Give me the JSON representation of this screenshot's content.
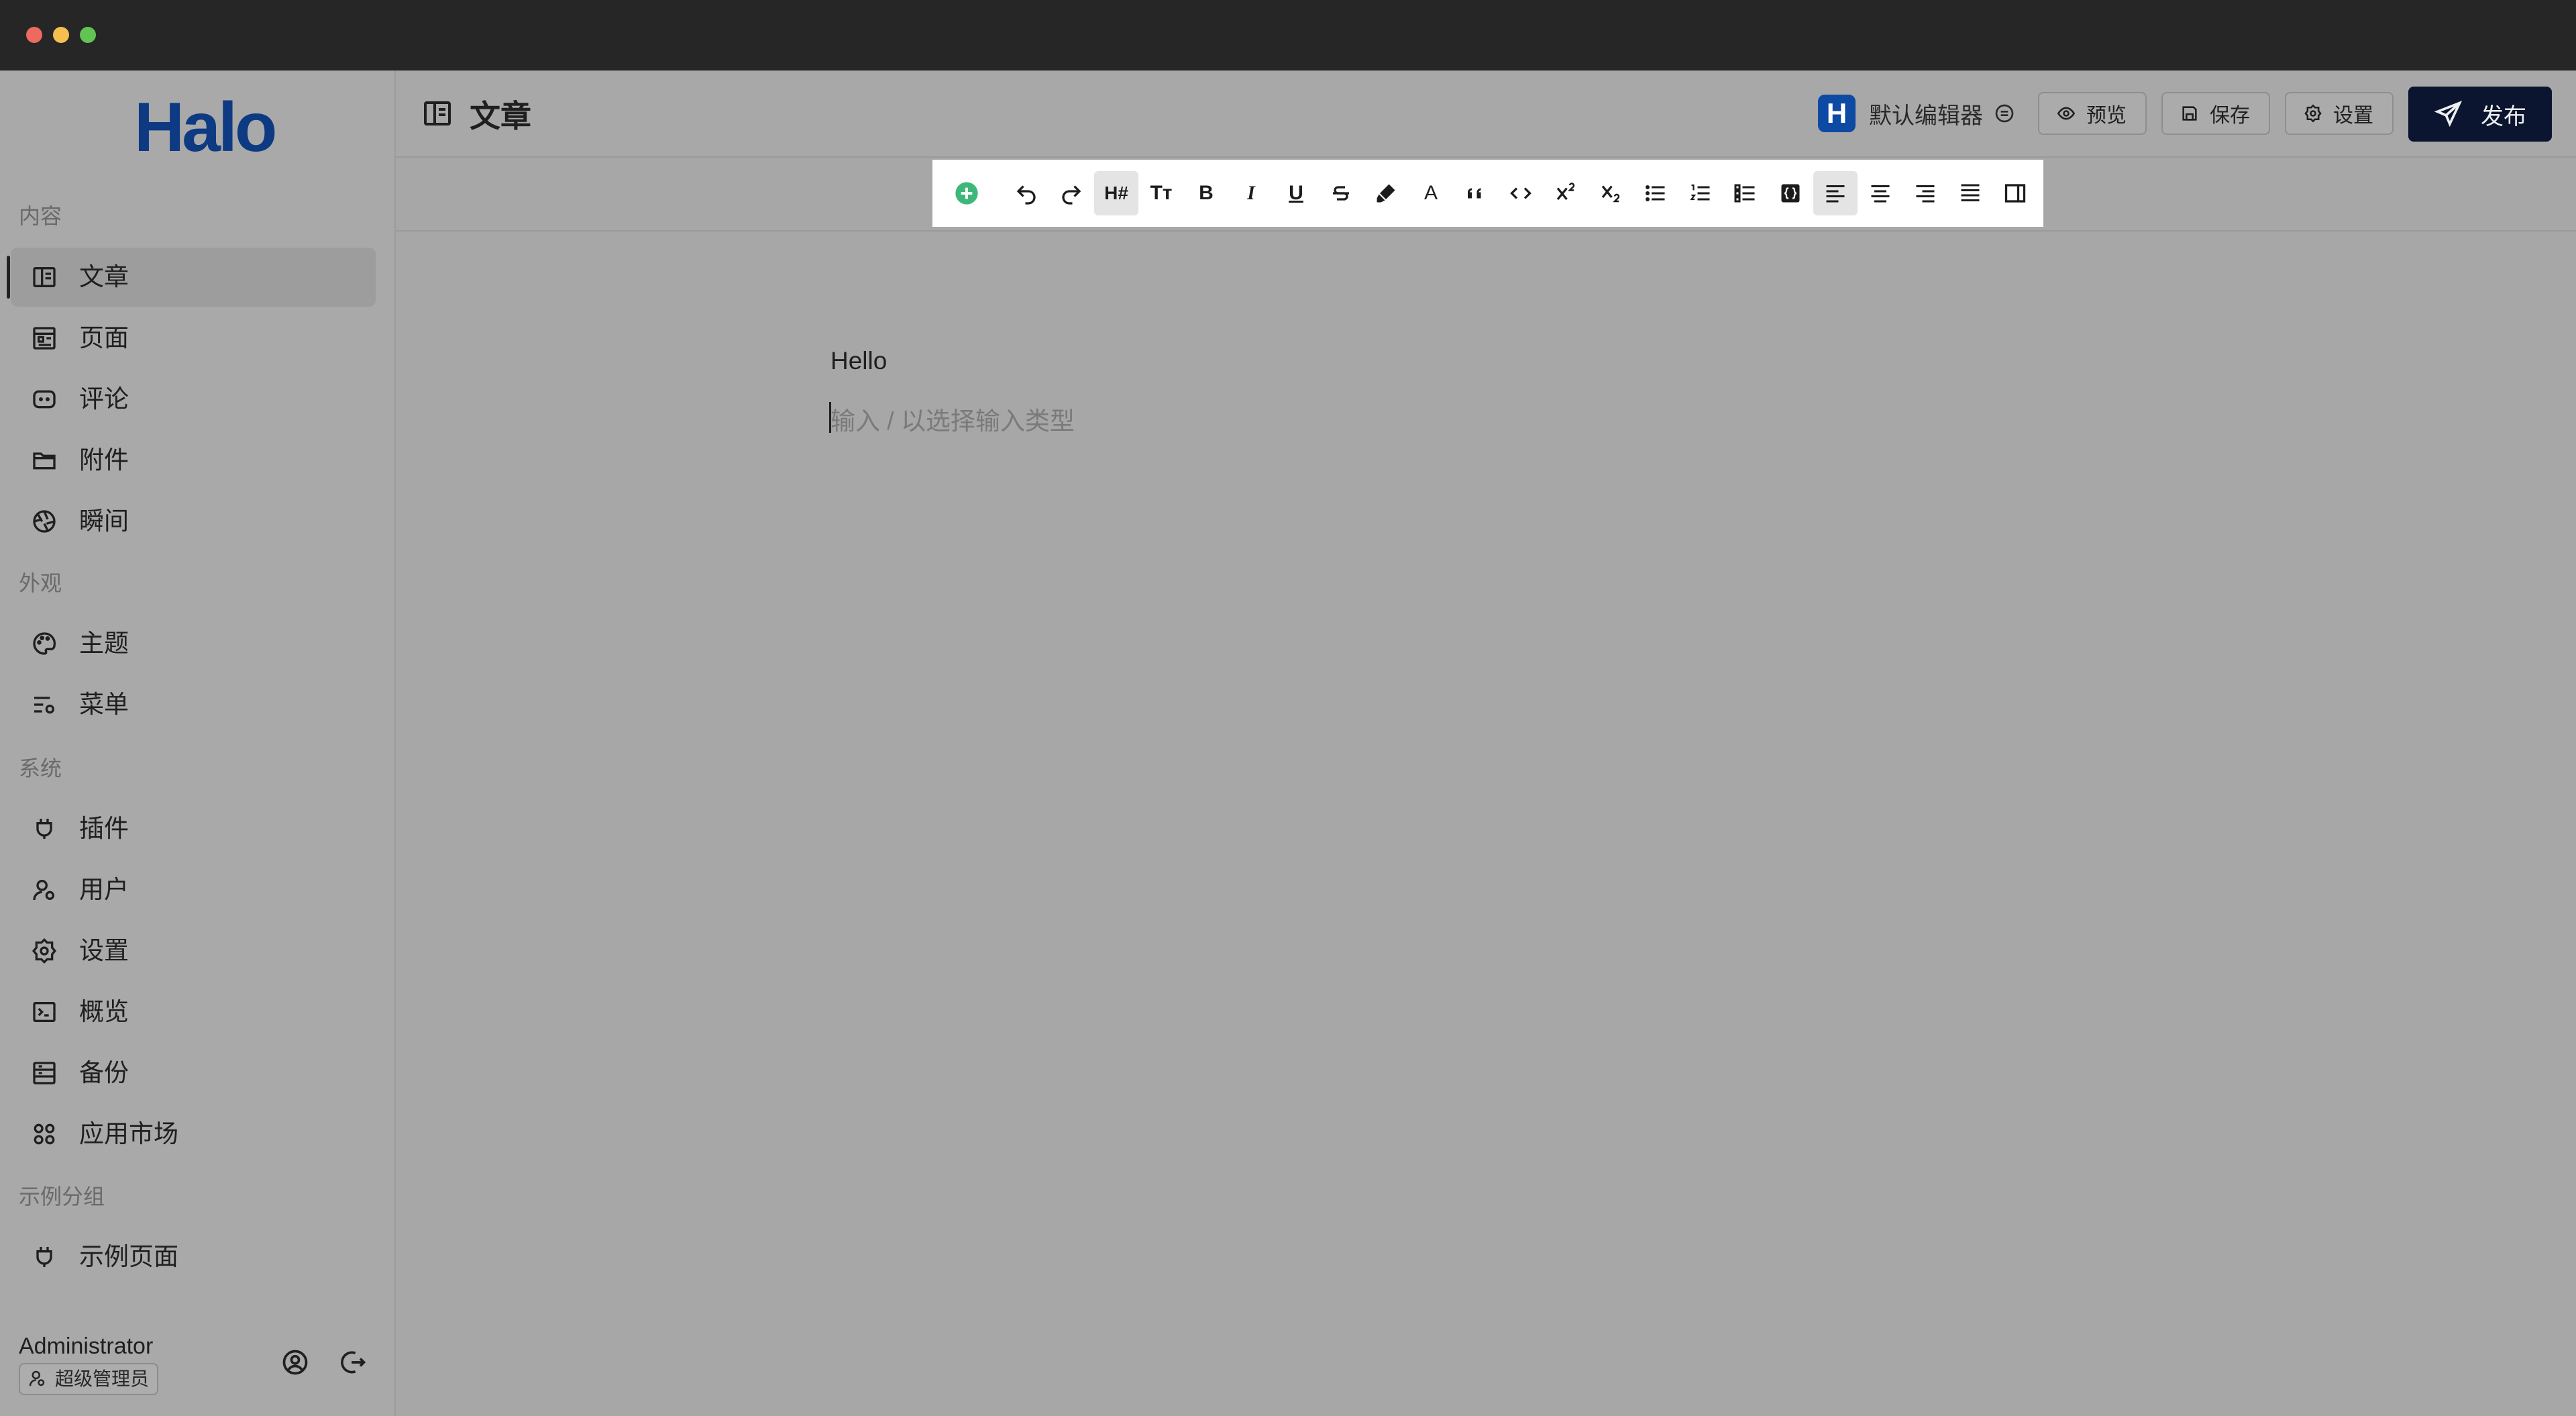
{
  "window": {
    "traffic_lights": [
      "close",
      "minimize",
      "zoom"
    ]
  },
  "sidebar": {
    "logo": "Halo",
    "groups": [
      {
        "title": "内容",
        "items": [
          {
            "label": "文章",
            "icon": "book-open-icon",
            "active": true
          },
          {
            "label": "页面",
            "icon": "page-layout-icon"
          },
          {
            "label": "评论",
            "icon": "comment-icon"
          },
          {
            "label": "附件",
            "icon": "folder-icon"
          },
          {
            "label": "瞬间",
            "icon": "aperture-icon"
          }
        ]
      },
      {
        "title": "外观",
        "items": [
          {
            "label": "主题",
            "icon": "palette-icon"
          },
          {
            "label": "菜单",
            "icon": "menu-settings-icon"
          }
        ]
      },
      {
        "title": "系统",
        "items": [
          {
            "label": "插件",
            "icon": "plug-icon"
          },
          {
            "label": "用户",
            "icon": "user-settings-icon"
          },
          {
            "label": "设置",
            "icon": "gear-icon"
          },
          {
            "label": "概览",
            "icon": "terminal-icon"
          },
          {
            "label": "备份",
            "icon": "backup-icon"
          },
          {
            "label": "应用市场",
            "icon": "apps-grid-icon"
          }
        ]
      },
      {
        "title": "示例分组",
        "items": [
          {
            "label": "示例页面",
            "icon": "plug-icon"
          }
        ]
      }
    ],
    "user": {
      "name": "Administrator",
      "role": "超级管理员"
    }
  },
  "header": {
    "title": "文章",
    "editor_name": "默认编辑器",
    "editor_logo": "H",
    "preview_label": "预览",
    "save_label": "保存",
    "settings_label": "设置",
    "publish_label": "发布"
  },
  "toolbar": {
    "items": [
      "add",
      "undo",
      "redo",
      "heading",
      "text-size",
      "bold",
      "italic",
      "underline",
      "strikethrough",
      "highlight",
      "font-color",
      "blockquote",
      "code",
      "superscript",
      "subscript",
      "bullet-list",
      "ordered-list",
      "task-list",
      "code-block",
      "align-left",
      "align-center",
      "align-right",
      "align-justify",
      "sidebar-toggle"
    ],
    "heading_glyph": "H#",
    "text_size_glyph": "Tт",
    "bold_glyph": "B",
    "italic_glyph": "I",
    "underline_glyph": "U",
    "font_color_glyph": "A"
  },
  "document": {
    "paragraph": "Hello",
    "placeholder": "输入 / 以选择输入类型"
  },
  "colors": {
    "publish_bg": "#0b1530",
    "logo": "#0d3a82",
    "add_button": "#3db87a",
    "editor_logo_bg": "#0d4aa3"
  }
}
